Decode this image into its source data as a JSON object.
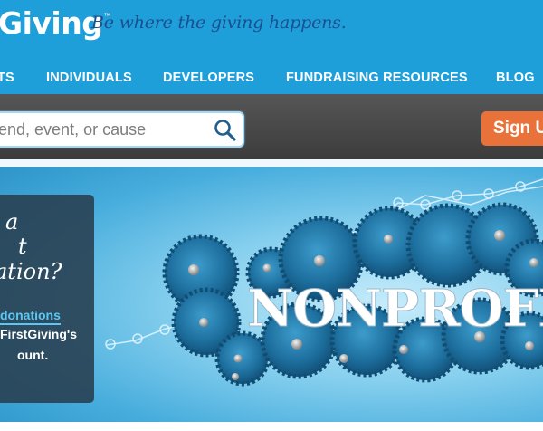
{
  "header": {
    "logo_text": "Giving",
    "logo_tm": "™",
    "tagline": "Be where the giving happens."
  },
  "nav": {
    "items": [
      {
        "label": "TS"
      },
      {
        "label": "INDIVIDUALS"
      },
      {
        "label": "DEVELOPERS"
      },
      {
        "label": "FUNDRAISING RESOURCES"
      },
      {
        "label": "BLOG"
      }
    ]
  },
  "search": {
    "placeholder": "end, event, or cause",
    "icon": "search-icon"
  },
  "signup": {
    "label": "Sign U"
  },
  "promo": {
    "headline_line1": "a",
    "headline_line2": "t",
    "headline_line3": "ation?",
    "link": "donations",
    "text_line1": "FirstGiving's",
    "text_line2": "ount."
  },
  "hero": {
    "word": "NONPROFI"
  },
  "colors": {
    "brand_blue": "#1e9fd9",
    "tagline_blue": "#1b4f90",
    "signup_orange": "#e9723b",
    "gear_blue": "#1c6f9c"
  }
}
